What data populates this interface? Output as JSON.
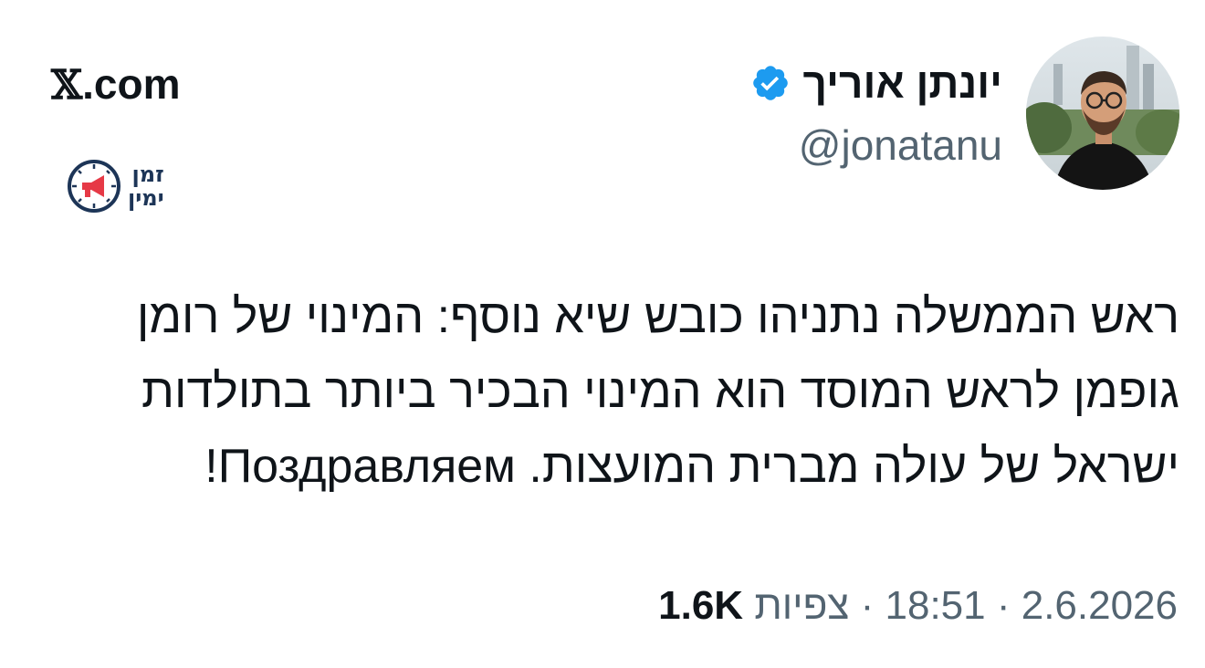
{
  "author": {
    "display_name": "יונתן אוריך",
    "handle": "@jonatanu",
    "verified": true
  },
  "brand": {
    "x_mark": "𝕏",
    "domain": ".com"
  },
  "source_logo": {
    "line1": "זמן",
    "line2": "ימין"
  },
  "tweet": {
    "lines": [
      "ראש הממשלה נתניהו כובש שיא נוסף: המינוי של רומן",
      "גופמן לראש המוסד הוא המינוי הבכיר ביותר בתולדות",
      "ישראל של עולה מברית המועצות. Поздравляем!"
    ]
  },
  "meta": {
    "date": "2.6.2026",
    "separator1": " · ",
    "time": "18:51",
    "separator2": " · ",
    "views_label": "צפיות",
    "views_count": "1.6K"
  },
  "colors": {
    "text_primary": "#0f1419",
    "text_secondary": "#536471",
    "verified_blue": "#1d9bf0",
    "logo_navy": "#1d3557",
    "logo_red": "#e63946"
  }
}
